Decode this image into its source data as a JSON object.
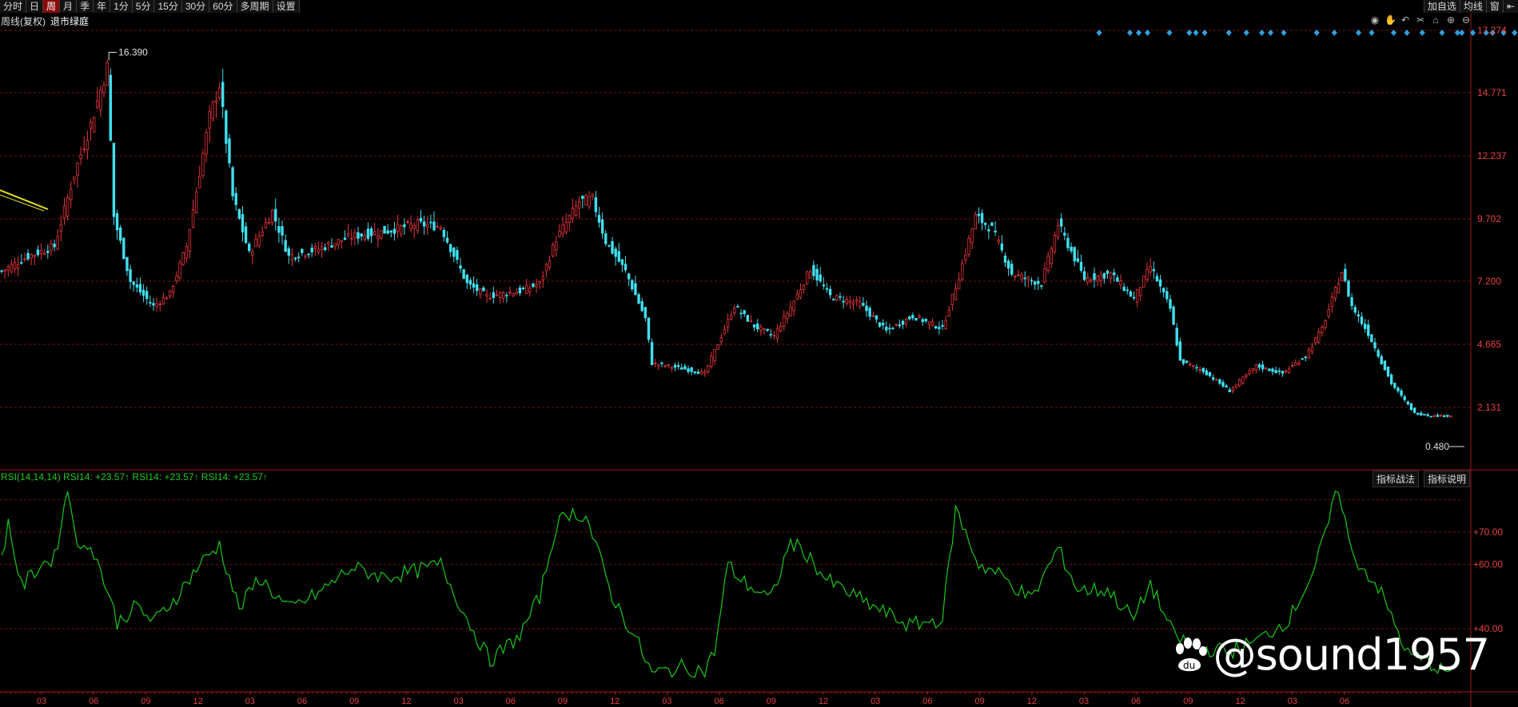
{
  "toolbar": {
    "periods": [
      "分时",
      "日",
      "周",
      "月",
      "季",
      "年",
      "1分",
      "5分",
      "15分",
      "30分",
      "60分",
      "多周期",
      "设置"
    ],
    "active": "周",
    "right_buttons": [
      "加自选",
      "均线",
      "窗"
    ]
  },
  "main_chart": {
    "label": "周线(复权)",
    "stock_name": "退市绿庭",
    "high_label": "16.390",
    "low_label": "0.480"
  },
  "rsi_panel": {
    "header": "RSI(14,14,14) RSI14: +23.57↑ RSI14: +23.57↑ RSI14: +23.57↑",
    "buttons": [
      "指标战法",
      "指标说明"
    ]
  },
  "tool_icons": [
    "eye-icon",
    "hand-icon",
    "undo-icon",
    "scissors-icon",
    "lock-icon",
    "zoom-in-icon",
    "zoom-out-icon"
  ],
  "watermark": "@sound1957",
  "colors": {
    "up": "#e8353a",
    "down": "#40e0f0",
    "rsi": "#18c818",
    "grid": "#7a1010",
    "axis_text": "#e84040",
    "event_marker": "#2fa0e0"
  },
  "chart_data": {
    "type": "candlestick",
    "price_axis": {
      "ticks": [
        17.274,
        14.771,
        12.237,
        9.702,
        7.2,
        4.665,
        2.131
      ],
      "tick_labels": [
        "17.274",
        "14.771",
        "12.237",
        "9.702",
        "7.200",
        "4.665",
        "2.131"
      ],
      "range": [
        0.48,
        17.274
      ]
    },
    "rsi_axis": {
      "ticks": [
        70,
        60,
        40
      ],
      "tick_labels": [
        "+70.00",
        "+60.00",
        "+40.00"
      ],
      "range": [
        0,
        100
      ]
    },
    "x_tick_labels": [
      "03",
      "06",
      "09",
      "12",
      "03",
      "06",
      "09",
      "12",
      "03",
      "06",
      "09",
      "12",
      "03",
      "06",
      "09",
      "12",
      "03",
      "06",
      "09",
      "12",
      "03",
      "06",
      "09",
      "12",
      "03",
      "06"
    ],
    "close_keypoints": [
      [
        0,
        7.6
      ],
      [
        8,
        8.2
      ],
      [
        16,
        8.6
      ],
      [
        22,
        11.5
      ],
      [
        27,
        13.5
      ],
      [
        32,
        15.8
      ],
      [
        34,
        9.8
      ],
      [
        39,
        7.2
      ],
      [
        46,
        6.2
      ],
      [
        51,
        6.7
      ],
      [
        56,
        8.6
      ],
      [
        63,
        13.8
      ],
      [
        66,
        15.1
      ],
      [
        70,
        10.6
      ],
      [
        75,
        8.3
      ],
      [
        82,
        10.0
      ],
      [
        87,
        8.2
      ],
      [
        96,
        8.5
      ],
      [
        106,
        9.0
      ],
      [
        116,
        9.2
      ],
      [
        126,
        9.5
      ],
      [
        133,
        9.4
      ],
      [
        141,
        7.1
      ],
      [
        147,
        6.6
      ],
      [
        157,
        6.8
      ],
      [
        163,
        7.1
      ],
      [
        168,
        8.9
      ],
      [
        175,
        10.4
      ],
      [
        179,
        10.5
      ],
      [
        183,
        8.8
      ],
      [
        189,
        7.6
      ],
      [
        195,
        5.7
      ],
      [
        197,
        3.9
      ],
      [
        206,
        3.7
      ],
      [
        213,
        3.5
      ],
      [
        218,
        5.0
      ],
      [
        222,
        6.2
      ],
      [
        228,
        5.4
      ],
      [
        234,
        5.0
      ],
      [
        240,
        6.4
      ],
      [
        245,
        7.7
      ],
      [
        251,
        6.6
      ],
      [
        260,
        6.3
      ],
      [
        268,
        5.2
      ],
      [
        276,
        5.8
      ],
      [
        285,
        5.3
      ],
      [
        290,
        7.4
      ],
      [
        295,
        9.8
      ],
      [
        300,
        9.3
      ],
      [
        306,
        7.5
      ],
      [
        315,
        7.1
      ],
      [
        320,
        9.5
      ],
      [
        328,
        7.3
      ],
      [
        336,
        7.5
      ],
      [
        343,
        6.5
      ],
      [
        348,
        7.8
      ],
      [
        354,
        6.1
      ],
      [
        357,
        4.0
      ],
      [
        364,
        3.6
      ],
      [
        372,
        2.8
      ],
      [
        380,
        3.8
      ],
      [
        388,
        3.5
      ],
      [
        395,
        4.2
      ],
      [
        400,
        5.3
      ],
      [
        406,
        7.6
      ],
      [
        409,
        6.2
      ],
      [
        414,
        5.1
      ],
      [
        421,
        3.1
      ],
      [
        428,
        1.9
      ],
      [
        433,
        1.8
      ]
    ],
    "rsi_keypoints": [
      [
        0,
        62
      ],
      [
        2,
        73
      ],
      [
        6,
        53
      ],
      [
        12,
        60
      ],
      [
        16,
        62
      ],
      [
        20,
        83
      ],
      [
        24,
        63
      ],
      [
        27,
        67
      ],
      [
        32,
        52
      ],
      [
        35,
        42
      ],
      [
        41,
        47
      ],
      [
        46,
        42
      ],
      [
        53,
        50
      ],
      [
        60,
        60
      ],
      [
        66,
        66
      ],
      [
        72,
        46
      ],
      [
        78,
        56
      ],
      [
        87,
        46
      ],
      [
        96,
        51
      ],
      [
        106,
        59
      ],
      [
        116,
        56
      ],
      [
        126,
        58
      ],
      [
        133,
        60
      ],
      [
        141,
        43
      ],
      [
        148,
        30
      ],
      [
        157,
        38
      ],
      [
        163,
        50
      ],
      [
        168,
        72
      ],
      [
        172,
        76
      ],
      [
        177,
        75
      ],
      [
        185,
        50
      ],
      [
        193,
        35
      ],
      [
        197,
        26
      ],
      [
        206,
        28
      ],
      [
        213,
        27
      ],
      [
        216,
        33
      ],
      [
        220,
        60
      ],
      [
        224,
        55
      ],
      [
        233,
        49
      ],
      [
        239,
        67
      ],
      [
        244,
        63
      ],
      [
        250,
        55
      ],
      [
        262,
        48
      ],
      [
        275,
        41
      ],
      [
        285,
        43
      ],
      [
        289,
        77
      ],
      [
        296,
        60
      ],
      [
        302,
        57
      ],
      [
        312,
        49
      ],
      [
        320,
        65
      ],
      [
        326,
        52
      ],
      [
        335,
        52
      ],
      [
        343,
        43
      ],
      [
        348,
        54
      ],
      [
        355,
        38
      ],
      [
        362,
        34
      ],
      [
        372,
        33
      ],
      [
        380,
        36
      ],
      [
        390,
        43
      ],
      [
        398,
        59
      ],
      [
        405,
        84
      ],
      [
        409,
        63
      ],
      [
        417,
        53
      ],
      [
        426,
        32
      ],
      [
        432,
        30
      ],
      [
        436,
        27
      ]
    ]
  }
}
